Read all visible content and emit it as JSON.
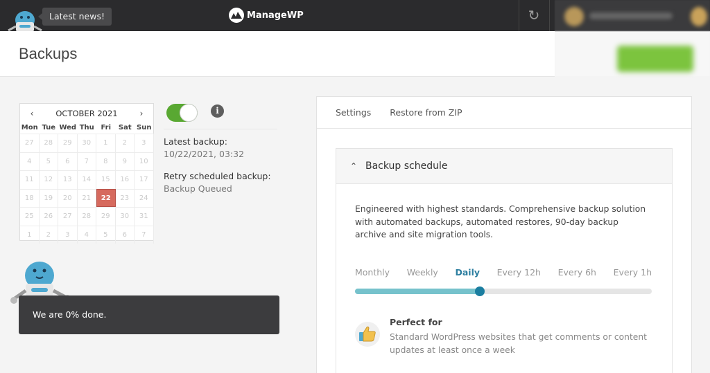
{
  "topbar": {
    "news_label": "Latest news!",
    "brand": "ManageWP",
    "refresh_icon": "refresh-icon"
  },
  "header": {
    "title": "Backups"
  },
  "calendar": {
    "month_label": "OCTOBER 2021",
    "prev_icon": "chevron-left-icon",
    "next_icon": "chevron-right-icon",
    "weekdays": [
      "Mon",
      "Tue",
      "Wed",
      "Thu",
      "Fri",
      "Sat",
      "Sun"
    ],
    "days": [
      "27",
      "28",
      "29",
      "30",
      "1",
      "2",
      "3",
      "4",
      "5",
      "6",
      "7",
      "8",
      "9",
      "10",
      "11",
      "12",
      "13",
      "14",
      "15",
      "16",
      "17",
      "18",
      "19",
      "20",
      "21",
      "22",
      "23",
      "24",
      "25",
      "26",
      "27",
      "28",
      "29",
      "30",
      "31",
      "1",
      "2",
      "3",
      "4",
      "5",
      "6",
      "7"
    ],
    "selected_day": "22"
  },
  "backup": {
    "toggle_on": true,
    "latest_label": "Latest backup:",
    "latest_value": "10/22/2021, 03:32",
    "retry_label": "Retry scheduled backup:",
    "retry_value": "Backup Queued"
  },
  "progress": {
    "message": "We are 0% done."
  },
  "tabs": [
    "Settings",
    "Restore from ZIP"
  ],
  "schedule": {
    "title": "Backup schedule",
    "description": "Engineered with highest standards. Comprehensive backup solution with automated backups, automated restores, 90-day backup archive and site migration tools.",
    "frequencies": [
      "Monthly",
      "Weekly",
      "Daily",
      "Every 12h",
      "Every 6h",
      "Every 1h"
    ],
    "selected_index": 2,
    "slider_value": 0.42,
    "perfect_for_label": "Perfect for",
    "perfect_for_text": "Standard WordPress websites that get comments or content updates at least once a week"
  },
  "colors": {
    "accent": "#1b7ea0",
    "toggle": "#59a832",
    "selected_day": "#d66a5e"
  }
}
